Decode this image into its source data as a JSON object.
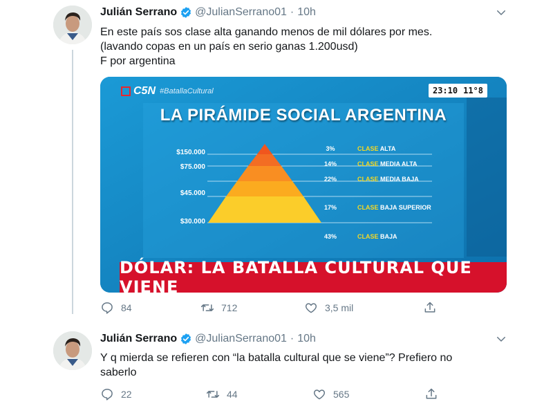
{
  "tweets": [
    {
      "name": "Julián Serrano",
      "handle": "@JulianSerrano01",
      "separator": "·",
      "time": "10h",
      "text_lines": [
        "En este país sos clase alta ganando menos de mil dólares por mes.",
        "(lavando copas en un país en serio ganas 1.200usd)",
        "F por argentina"
      ],
      "replies": "84",
      "retweets": "712",
      "likes": "3,5 mil"
    },
    {
      "name": "Julián Serrano",
      "handle": "@JulianSerrano01",
      "separator": "·",
      "time": "10h",
      "text_lines": [
        "Y q mierda se refieren con “la batalla cultural que se viene”? Prefiero no",
        "saberlo"
      ],
      "replies": "22",
      "retweets": "44",
      "likes": "565"
    }
  ],
  "media": {
    "channel": "C5N",
    "hashtag": "#BatallaCultural",
    "clock_time": "23:10",
    "clock_temp": "11°8",
    "title": "LA PIRÁMIDE SOCIAL ARGENTINA",
    "prices": [
      "$150.000",
      "$75.000",
      "$45.000",
      "$30.000"
    ],
    "levels": [
      {
        "pct": "3%",
        "clase": "CLASE",
        "label": "ALTA"
      },
      {
        "pct": "14%",
        "clase": "CLASE",
        "label": "MEDIA ALTA"
      },
      {
        "pct": "22%",
        "clase": "CLASE",
        "label": "MEDIA BAJA"
      },
      {
        "pct": "17%",
        "clase": "CLASE",
        "label": "BAJA SUPERIOR"
      },
      {
        "pct": "43%",
        "clase": "CLASE",
        "label": "BAJA"
      }
    ],
    "banner": "DÓLAR: LA BATALLA CULTURAL QUE VIENE"
  },
  "icons": {
    "reply": "reply-icon",
    "retweet": "retweet-icon",
    "like": "heart-icon",
    "share": "share-icon",
    "verified": "verified-badge-icon",
    "caret": "chevron-down-icon"
  },
  "colors": {
    "text": "#14171a",
    "secondary": "#657786",
    "verified": "#1da1f2",
    "thread_line": "#ccd6dd",
    "media_blue": "#1c8ecb",
    "banner_red": "#d6112b"
  }
}
